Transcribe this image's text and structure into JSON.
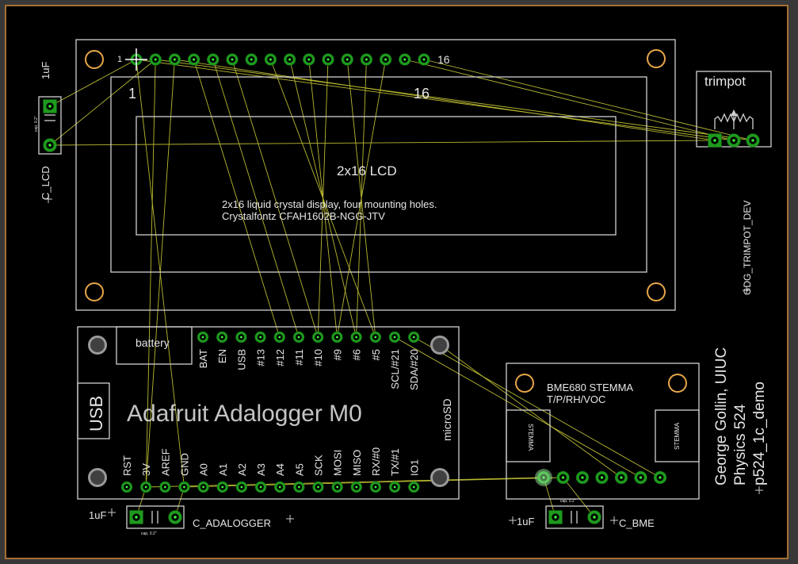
{
  "lcd": {
    "title": "2x16 LCD",
    "description_line1": "2x16 liquid crystal display, four mounting holes.",
    "description_line2": "Crystalfontz CFAH1602B-NGG-JTV",
    "pin_first_label": "1",
    "pin_last_label": "16",
    "inner_first_label": "1",
    "inner_last_label": "16"
  },
  "trimpot": {
    "title": "trimpot",
    "name": "GDG_TRIMPOT_DEV"
  },
  "c_lcd": {
    "name": "C_LCD",
    "value": "1uF",
    "pkg": "cap, 0.2\""
  },
  "adalogger": {
    "title": "Adafruit Adalogger M0",
    "battery_label": "battery",
    "usb_label": "USB",
    "microsd_label": "microSD",
    "top_pins": [
      "BAT",
      "EN",
      "USB",
      "#13",
      "#12",
      "#11",
      "#10",
      "#9",
      "#6",
      "#5",
      "SCL/#21",
      "SDA/#20"
    ],
    "bottom_pins": [
      "RST",
      "3V",
      "AREF",
      "GND",
      "A0",
      "A1",
      "A2",
      "A3",
      "A4",
      "A5",
      "SCK",
      "MOSI",
      "MISO",
      "RX/#0",
      "TX/#1",
      "IO1"
    ]
  },
  "c_adalogger": {
    "name": "C_ADALOGGER",
    "value": "1uF",
    "pkg": "cap, 0.2\""
  },
  "bme": {
    "title_line1": "BME680 STEMMA",
    "title_line2": "T/P/RH/VOC",
    "stemma_left": "STEMMA",
    "stemma_right": "STEMMA"
  },
  "c_bme": {
    "name": "C_BME",
    "value": "1uF",
    "pkg": "cap, 0.2\""
  },
  "credits": {
    "line1": "George Gollin, UIUC",
    "line2": "Physics 524",
    "line3": "p524_1c_demo"
  },
  "colors": {
    "background": "#000000",
    "frame": "#383838",
    "border": "#d08a3a",
    "silkscreen": "#d0d0d0",
    "pad": "#1e9a1e",
    "airwire": "#b8b832",
    "mount_hole": "#e8a64a"
  }
}
